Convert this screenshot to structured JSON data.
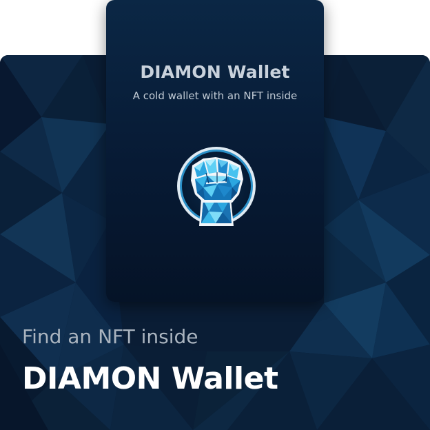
{
  "card": {
    "title": "DIAMON Wallet",
    "subtitle": "A cold wallet with an NFT inside"
  },
  "hero": {
    "kicker": "Find an NFT inside",
    "title": "DIAMON Wallet"
  },
  "icons": {
    "emblem": "diamond-fist-icon",
    "background": "low-poly-pattern"
  },
  "colors": {
    "background": "#0a1c33",
    "card": "#071a34",
    "accent": "#3fb8f0",
    "text": "#ffffff"
  }
}
